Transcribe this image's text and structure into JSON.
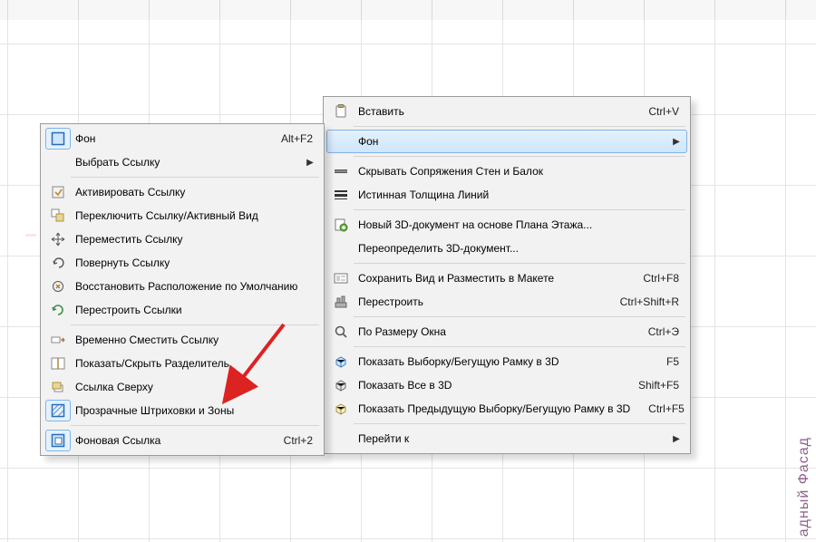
{
  "background": {
    "vertical_text_right": "адный Фасад"
  },
  "menu_left": {
    "items": [
      {
        "label": "Фон",
        "shortcut": "Alt+F2",
        "submenu": false,
        "highlighted": false,
        "active_icon": true
      },
      {
        "label": "Выбрать Ссылку",
        "shortcut": "",
        "submenu": true,
        "highlighted": false,
        "no_icon": true
      },
      {
        "sep": true
      },
      {
        "label": "Активировать Ссылку",
        "shortcut": "",
        "submenu": false
      },
      {
        "label": "Переключить Ссылку/Активный Вид",
        "shortcut": "",
        "submenu": false
      },
      {
        "label": "Переместить Ссылку",
        "shortcut": "",
        "submenu": false
      },
      {
        "label": "Повернуть Ссылку",
        "shortcut": "",
        "submenu": false
      },
      {
        "label": "Восстановить Расположение по Умолчанию",
        "shortcut": "",
        "submenu": false
      },
      {
        "label": "Перестроить Ссылки",
        "shortcut": "",
        "submenu": false
      },
      {
        "sep": true
      },
      {
        "label": "Временно Сместить Ссылку",
        "shortcut": "",
        "submenu": false
      },
      {
        "label": "Показать/Скрыть Разделитель",
        "shortcut": "",
        "submenu": false
      },
      {
        "label": "Ссылка Сверху",
        "shortcut": "",
        "submenu": false
      },
      {
        "label": "Прозрачные Штриховки и Зоны",
        "shortcut": "",
        "submenu": false,
        "active_icon": true
      },
      {
        "sep": true
      },
      {
        "label": "Фоновая Ссылка",
        "shortcut": "Ctrl+2",
        "submenu": false,
        "active_icon": true
      }
    ]
  },
  "menu_right": {
    "items": [
      {
        "label": "Вставить",
        "shortcut": "Ctrl+V",
        "submenu": false
      },
      {
        "sep": true
      },
      {
        "label": "Фон",
        "shortcut": "",
        "submenu": true,
        "highlighted": true,
        "no_icon": true
      },
      {
        "sep": true
      },
      {
        "label": "Скрывать Сопряжения Стен и Балок",
        "shortcut": "",
        "submenu": false
      },
      {
        "label": "Истинная Толщина Линий",
        "shortcut": "",
        "submenu": false
      },
      {
        "sep": true
      },
      {
        "label": "Новый 3D-документ на основе Плана Этажа...",
        "shortcut": "",
        "submenu": false
      },
      {
        "label": "Переопределить 3D-документ...",
        "shortcut": "",
        "submenu": false,
        "no_icon": true
      },
      {
        "sep": true
      },
      {
        "label": "Сохранить Вид и Разместить в Макете",
        "shortcut": "Ctrl+F8",
        "submenu": false
      },
      {
        "label": "Перестроить",
        "shortcut": "Ctrl+Shift+R",
        "submenu": false
      },
      {
        "sep": true
      },
      {
        "label": "По Размеру Окна",
        "shortcut": "Ctrl+Э",
        "submenu": false
      },
      {
        "sep": true
      },
      {
        "label": "Показать Выборку/Бегущую Рамку в 3D",
        "shortcut": "F5",
        "submenu": false
      },
      {
        "label": "Показать Все в 3D",
        "shortcut": "Shift+F5",
        "submenu": false
      },
      {
        "label": "Показать Предыдущую Выборку/Бегущую Рамку в 3D",
        "shortcut": "Ctrl+F5",
        "submenu": false
      },
      {
        "sep": true
      },
      {
        "label": "Перейти к",
        "shortcut": "",
        "submenu": true,
        "no_icon": true
      }
    ]
  }
}
